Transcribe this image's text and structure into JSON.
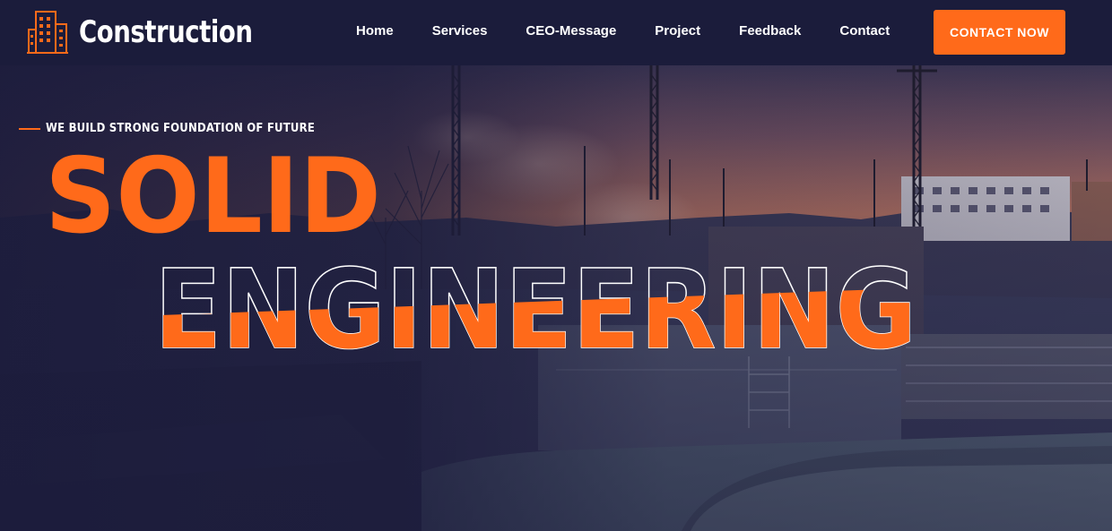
{
  "header": {
    "brand": "Construction",
    "logo_icon": "building-icon",
    "nav": [
      {
        "label": "Home"
      },
      {
        "label": "Services"
      },
      {
        "label": "CEO-Message"
      },
      {
        "label": "Project"
      },
      {
        "label": "Feedback"
      },
      {
        "label": "Contact"
      }
    ],
    "cta_label": "CONTACT NOW"
  },
  "hero": {
    "tagline": "WE BUILD STRONG FOUNDATION OF FUTURE",
    "headline_top": "SOLID",
    "headline_bottom": "ENGINEERING",
    "background": "construction-site-dusk-photo"
  },
  "colors": {
    "accent": "#ff6a1a",
    "navbar": "#1b1c3b",
    "text": "#ffffff"
  }
}
